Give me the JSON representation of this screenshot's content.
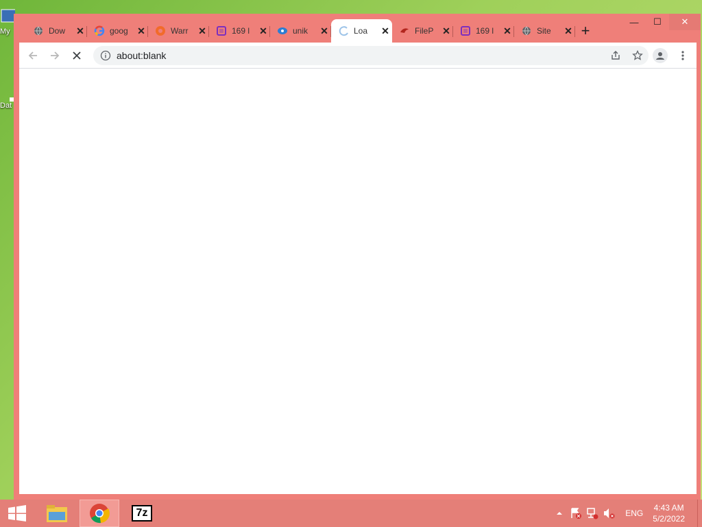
{
  "desktop": {
    "icons": [
      {
        "label": "My"
      },
      {
        "label": "Dat"
      }
    ]
  },
  "browser": {
    "tabs": [
      {
        "title": "Dow",
        "icon": "globe-icon"
      },
      {
        "title": "goog",
        "icon": "google-icon"
      },
      {
        "title": "Warr",
        "icon": "warranty-site-icon"
      },
      {
        "title": "169 l",
        "icon": "purple-square-icon"
      },
      {
        "title": "unik",
        "icon": "eye-icon"
      },
      {
        "title": "Loa",
        "icon": "loading-spinner-icon",
        "active": true
      },
      {
        "title": "FileP",
        "icon": "filepuma-icon"
      },
      {
        "title": "169 l",
        "icon": "purple-square-icon"
      },
      {
        "title": "Site",
        "icon": "globe-icon"
      }
    ],
    "close_tab_glyph": "✕",
    "new_tab_glyph": "+",
    "address": "about:blank"
  },
  "taskbar": {
    "apps": [
      "file-explorer-icon",
      "chrome-icon",
      "7zip-icon"
    ],
    "sevenzip_label": "7z",
    "language": "ENG",
    "time": "4:43 AM",
    "date": "5/2/2022"
  },
  "colors": {
    "window_frame": "#ef7f79",
    "taskbar": "#e47f78",
    "desktop": "#8cc64d"
  }
}
